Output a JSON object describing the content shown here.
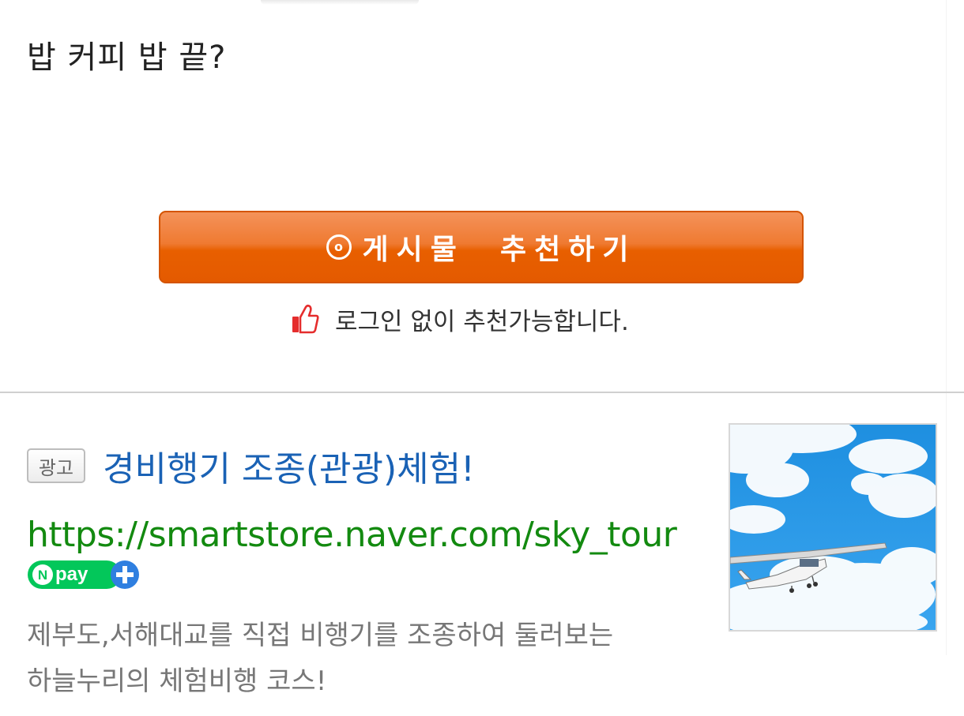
{
  "post": {
    "body_text": "밥 커피 밥 끝?"
  },
  "recommend": {
    "icon": "target-circle-icon",
    "button_label": "게시물  추천하기",
    "note_icon": "thumbs-up-icon",
    "note_text": "로그인 없이 추천가능합니다."
  },
  "ad": {
    "badge": "광고",
    "title": "경비행기 조종(관광)체험!",
    "url": "https://smartstore.naver.com/sky_tour",
    "npay_label": "Npay+",
    "description_lines": [
      "제부도,서해대교를 직접 비행기를 조종하여 둘러보는",
      "하늘누리의 체험비행 코스!"
    ],
    "image_subject": "small airplane in blue sky with clouds"
  },
  "colors": {
    "button_orange": "#e85f00",
    "ad_title_blue": "#1a62b5",
    "url_green": "#138a10",
    "npay_green": "#03c75a",
    "npay_blue": "#2f7fe0"
  }
}
